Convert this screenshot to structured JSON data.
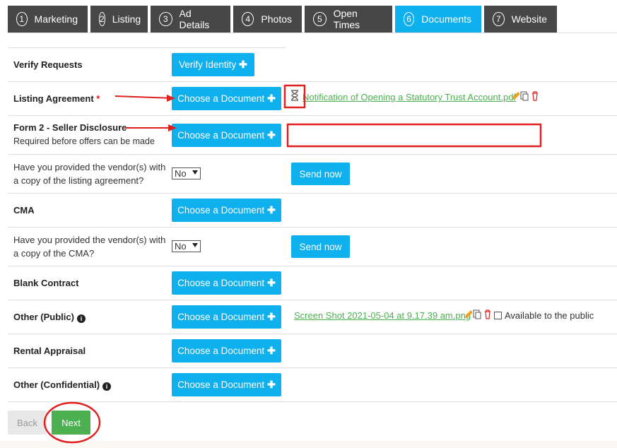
{
  "tabs": [
    {
      "num": "1",
      "label": "Marketing"
    },
    {
      "num": "2",
      "label": "Listing"
    },
    {
      "num": "3",
      "label": "Ad Details"
    },
    {
      "num": "4",
      "label": "Photos"
    },
    {
      "num": "5",
      "label": "Open Times"
    },
    {
      "num": "6",
      "label": "Documents"
    },
    {
      "num": "7",
      "label": "Website"
    }
  ],
  "rows": {
    "verify": {
      "label": "Verify Requests",
      "button": "Verify Identity"
    },
    "listing_agreement": {
      "label": "Listing Agreement",
      "required": "*",
      "button": "Choose a Document",
      "file": "Notification of Opening a Statutory Trust Account.pdf"
    },
    "form2": {
      "label": "Form 2 - Seller Disclosure",
      "sub": "Required before offers can be made",
      "button": "Choose a Document"
    },
    "q_listing": {
      "line1": "Have you provided the vendor(s) with",
      "line2": "a copy of the listing agreement?",
      "select": "No",
      "button": "Send now"
    },
    "cma": {
      "label": "CMA",
      "button": "Choose a Document"
    },
    "q_cma": {
      "line1": "Have you provided the vendor(s) with",
      "line2": "a copy of the CMA?",
      "select": "No",
      "button": "Send now"
    },
    "blank_contract": {
      "label": "Blank Contract",
      "button": "Choose a Document"
    },
    "other_public": {
      "label": "Other (Public)",
      "button": "Choose a Document",
      "file": "Screen Shot 2021-05-04 at 9.17.39 am.png",
      "public_label": "Available to the public"
    },
    "rental": {
      "label": "Rental Appraisal",
      "button": "Choose a Document"
    },
    "other_conf": {
      "label": "Other (Confidential)",
      "button": "Choose a Document"
    }
  },
  "plus_glyph": "✚",
  "info_glyph": "i",
  "nav": {
    "back": "Back",
    "next": "Next"
  },
  "colors": {
    "accent": "#0fb0ee",
    "tab_dark": "#474747",
    "success": "#4caf50",
    "annotation": "#e02020"
  }
}
